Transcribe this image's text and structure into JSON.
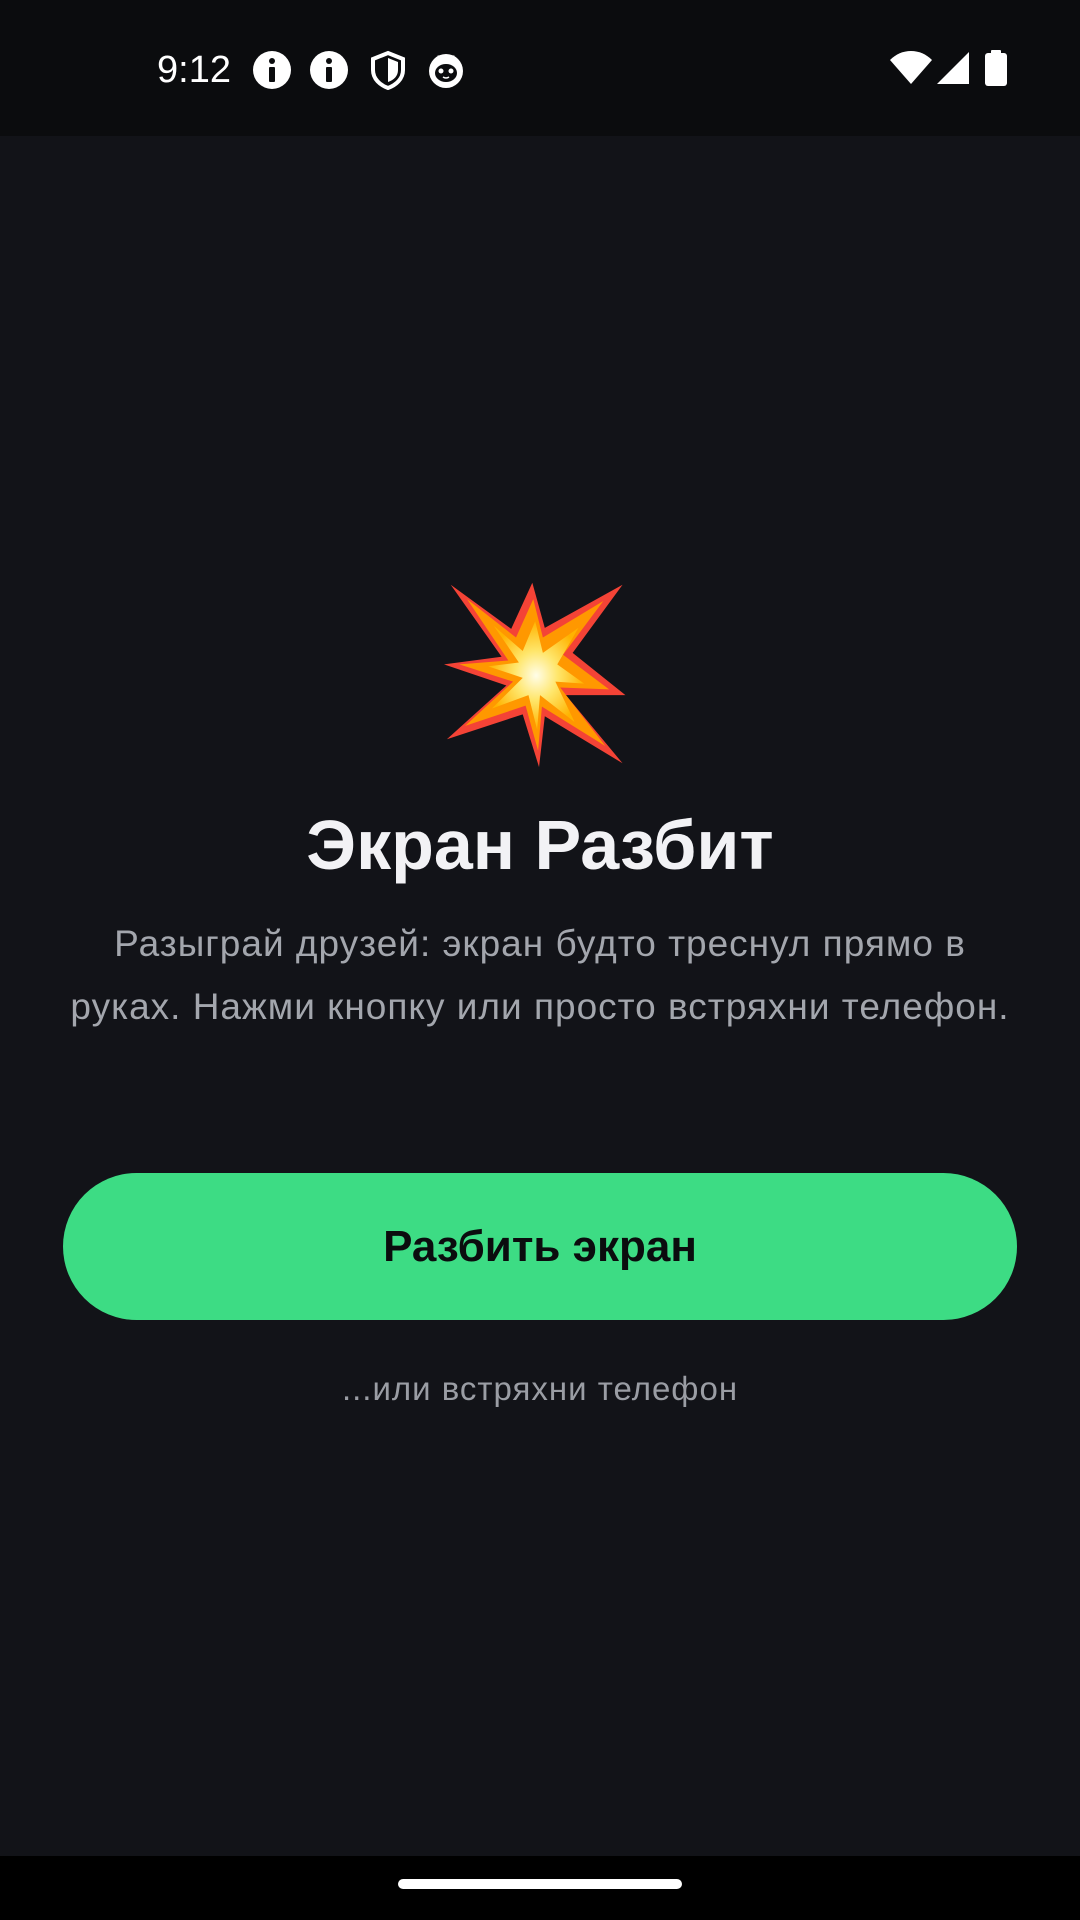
{
  "status_bar": {
    "time": "9:12",
    "left_icons": [
      "info-icon",
      "info-icon",
      "shield-icon",
      "cat-icon"
    ],
    "right_icons": [
      "wifi-icon",
      "cellular-signal-icon",
      "battery-icon"
    ]
  },
  "main": {
    "emoji_icon": "collision-emoji-icon",
    "title": "Экран Разбит",
    "description": "Разыграй друзей: экран будто треснул прямо в руках. Нажми кнопку или просто встряхни телефон.",
    "button_label": "Разбить экран",
    "hint": "...или встряхни телефон"
  },
  "colors": {
    "background": "#121318",
    "accent": "#3ddc84",
    "title": "#f2f2f5",
    "secondary_text": "#a3a6ad"
  }
}
